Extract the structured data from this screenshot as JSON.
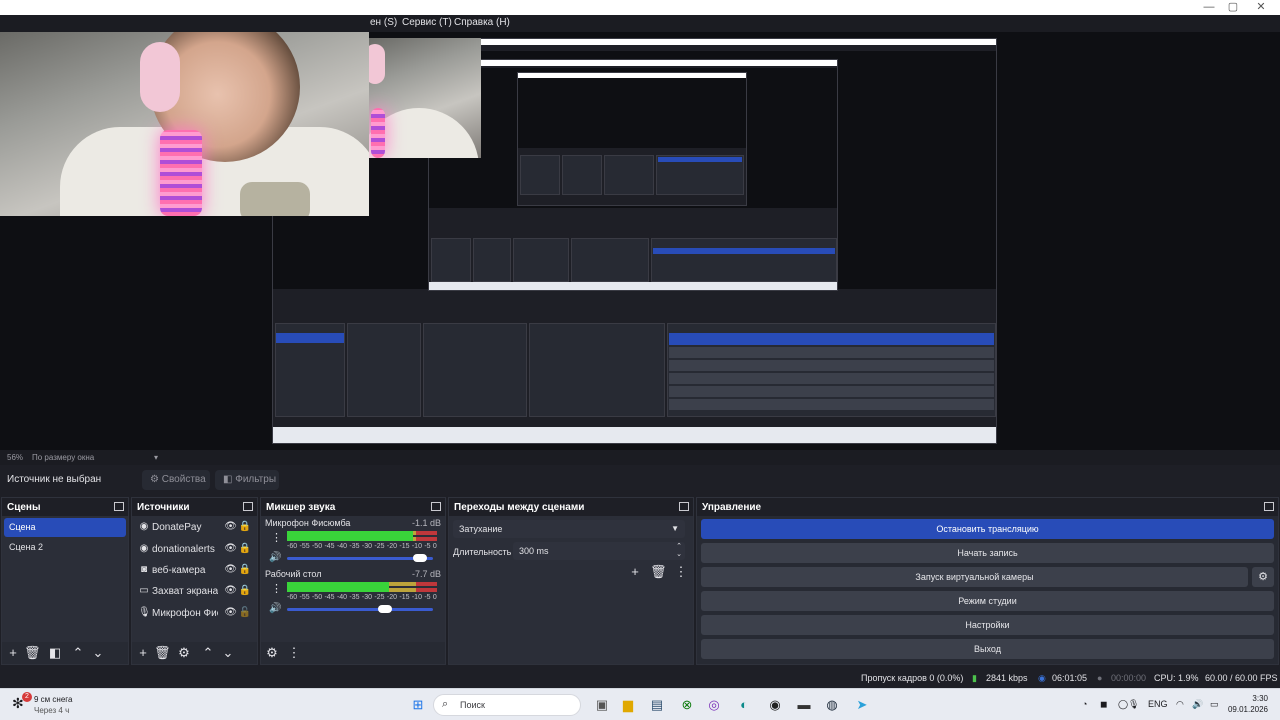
{
  "menu": {
    "items": [
      "ен (S)",
      "Сервис (T)",
      "Справка (H)"
    ]
  },
  "window_controls": {
    "minimize": "—",
    "maximize": "▢",
    "close": "✕"
  },
  "preview": {
    "zoom": "56%",
    "zoom_mode": "По размеру окна",
    "nested_texts": {
      "source_none": "Источник не выбран",
      "properties": "Свойства",
      "filters": "Фильтры",
      "scenes": "Сцены",
      "sources": "Источники",
      "mixer": "Микшер звука",
      "transitions": "Переходы между сценами",
      "controls": "Управление"
    }
  },
  "source_bar": {
    "no_source": "Источник не выбран",
    "properties_label": "Свойства",
    "filters_label": "Фильтры"
  },
  "scenes": {
    "title": "Сцены",
    "items": [
      {
        "label": "Сцена",
        "selected": true
      },
      {
        "label": "Сцена 2",
        "selected": false
      }
    ]
  },
  "sources": {
    "title": "Источники",
    "items": [
      {
        "label": "DonatePay",
        "icon": "globe-icon",
        "locked": true
      },
      {
        "label": "donationalerts",
        "icon": "globe-icon",
        "locked": true
      },
      {
        "label": "веб-камера",
        "icon": "camera-icon",
        "locked": true
      },
      {
        "label": "Захват экрана",
        "icon": "monitor-icon",
        "locked": true
      },
      {
        "label": "Микрофон Фиск",
        "icon": "microphone-icon",
        "locked": false
      }
    ]
  },
  "mixer": {
    "title": "Микшер звука",
    "ticks": [
      "-60",
      "-55",
      "-50",
      "-45",
      "-40",
      "-35",
      "-30",
      "-25",
      "-20",
      "-15",
      "-10",
      "-5",
      "0"
    ],
    "channels": [
      {
        "name": "Микрофон Фисюмба",
        "db": "-1.1 dB",
        "level": 0.84,
        "volume": 0.96
      },
      {
        "name": "Рабочий стол",
        "db": "-7.7 dB",
        "level": 0.68,
        "volume": 0.72
      }
    ]
  },
  "transitions": {
    "title": "Переходы между сценами",
    "selected": "Затухание",
    "duration_label": "Длительность",
    "duration_value": "300 ms"
  },
  "controls": {
    "title": "Управление",
    "stop_stream": "Остановить трансляцию",
    "start_record": "Начать запись",
    "virtual_cam": "Запуск виртуальной камеры",
    "studio_mode": "Режим студии",
    "settings": "Настройки",
    "exit": "Выход"
  },
  "status": {
    "dropped": "Пропуск кадров 0 (0.0%)",
    "bitrate": "2841 kbps",
    "stream_time": "06:01:05",
    "record_time": "00:00:00",
    "cpu": "CPU: 1.9%",
    "fps": "60.00 / 60.00 FPS"
  },
  "taskbar": {
    "weather_line1": "9 см снега",
    "weather_line2": "Через 4 ч",
    "weather_badge": "2",
    "search_placeholder": "Поиск",
    "lang": "ENG",
    "time": "3:30",
    "date": "09.01.2026"
  },
  "colors": {
    "accent": "#284cb8",
    "panel": "#272a33",
    "bg": "#1e1f26"
  }
}
